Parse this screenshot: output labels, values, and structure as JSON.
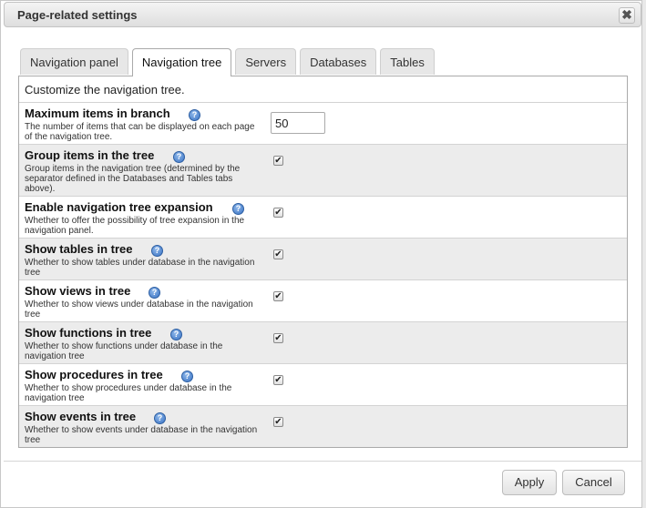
{
  "dialog": {
    "title": "Page-related settings",
    "close_glyph": "✖"
  },
  "tabs": [
    {
      "label": "Navigation panel",
      "active": false
    },
    {
      "label": "Navigation tree",
      "active": true
    },
    {
      "label": "Servers",
      "active": false
    },
    {
      "label": "Databases",
      "active": false
    },
    {
      "label": "Tables",
      "active": false
    }
  ],
  "panel": {
    "description": "Customize the navigation tree.",
    "settings": [
      {
        "label": "Maximum items in branch",
        "desc_lines": [
          "The number of items that can be displayed on each page",
          "of the navigation tree."
        ],
        "type": "number",
        "value": "50"
      },
      {
        "label": "Group items in the tree",
        "desc_lines": [
          "Group items in the navigation tree (determined by the",
          "separator defined in the Databases and Tables tabs",
          "above)."
        ],
        "type": "checkbox",
        "checked": true
      },
      {
        "label": "Enable navigation tree expansion",
        "desc_lines": [
          "Whether to offer the possibility of tree expansion in the",
          "navigation panel."
        ],
        "type": "checkbox",
        "checked": true
      },
      {
        "label": "Show tables in tree",
        "desc_lines": [
          "Whether to show tables under database in the navigation",
          "tree"
        ],
        "type": "checkbox",
        "checked": true
      },
      {
        "label": "Show views in tree",
        "desc_lines": [
          "Whether to show views under database in the navigation",
          "tree"
        ],
        "type": "checkbox",
        "checked": true
      },
      {
        "label": "Show functions in tree",
        "desc_lines": [
          "Whether to show functions under database in the",
          "navigation tree"
        ],
        "type": "checkbox",
        "checked": true
      },
      {
        "label": "Show procedures in tree",
        "desc_lines": [
          "Whether to show procedures under database in the",
          "navigation tree"
        ],
        "type": "checkbox",
        "checked": true
      },
      {
        "label": "Show events in tree",
        "desc_lines": [
          "Whether to show events under database in the navigation",
          "tree"
        ],
        "type": "checkbox",
        "checked": true
      }
    ]
  },
  "footer": {
    "apply_label": "Apply",
    "cancel_label": "Cancel"
  },
  "icons": {
    "help": "help-icon",
    "help_glyph": "?",
    "check_glyph": "✔"
  },
  "colors": {
    "alt_row": "#ececec",
    "help_blue": "#3a73c4"
  }
}
